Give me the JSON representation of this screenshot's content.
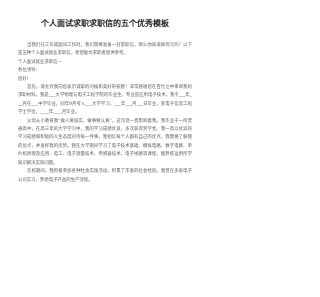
{
  "document": {
    "title": "个人面试求职求职信的五个优秀模板",
    "paragraphs": [
      {
        "text": "当我们在工作或面试工作时，我们需要准备一封求职信，那么你知道如何写吗？以下是五种个人面试就业求职信，希望能为求职者提供参考。",
        "indent": true
      },
      {
        "text": "个人面试就业求职信一",
        "indent": false
      },
      {
        "text": "各位领导：",
        "indent": false
      },
      {
        "text": "您好！",
        "indent": false
      },
      {
        "text": "首先，请允许我向您表示诚挚的问候和美好的祝愿！非常感谢您在百忙之中审阅我的求职材料。我是___大学物理与电子工程学院的毕业生，专业是应用电子技术。我于___年___月在___中学毕业，同年9月考入___大学学习，___年___月___日毕业，获电子信息工程学士学位，____年____月毕业。",
        "indent": true
      },
      {
        "text": "父母从小教育我“做人要诚实，做事要认真”，这句话一直影响着我。我毕业于一所普通高中，在高三年的大学学习中，我的学习成绩优良，多次获得奖学金。我一直以优异的学习成绩和积极的人生态度对待每一件事，我相信每个人都有自己的优点，我需要了解我的优点，并发挥我的优势。我在大学期间学习了电子技术基础、模拟电路、数字电路、单片机原理及应用、电工、电子测量技术、传感器技术、电子线路等课程，能熟练运用所学知识解决实际问题。",
        "indent": true
      },
      {
        "text": "在校期间，我积极参加各种社会实践活动，积累了丰富的社会经验。我曾在多家电子公司实习，熟悉电子产品的生产流程。",
        "indent": true
      }
    ]
  }
}
